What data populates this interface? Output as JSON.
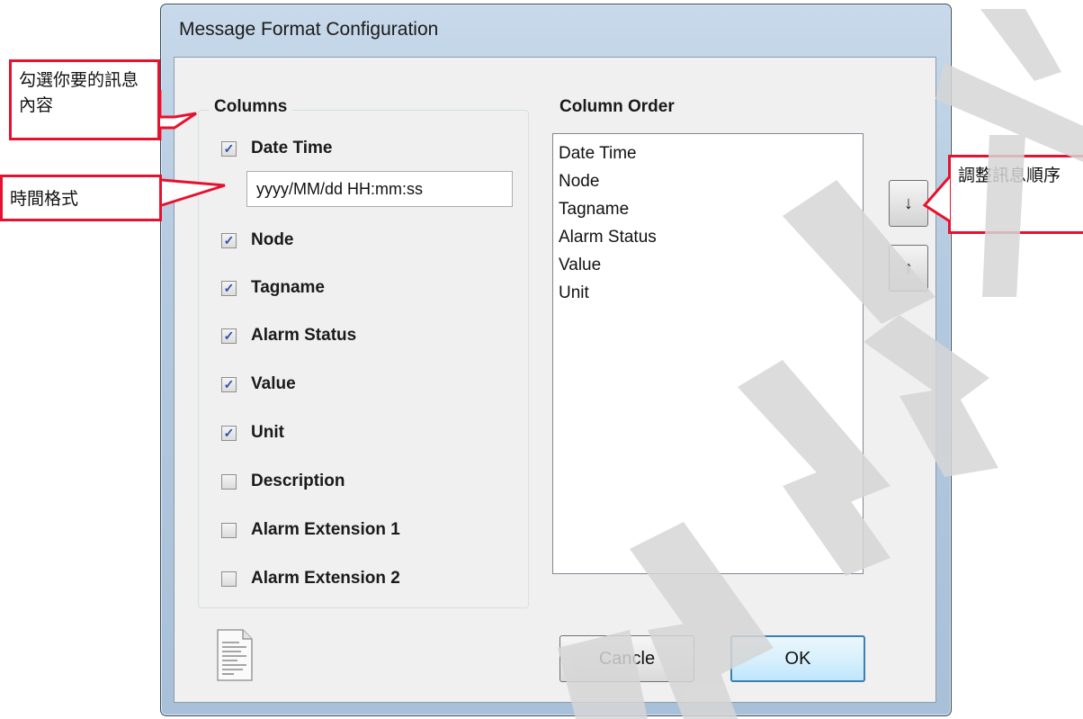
{
  "window": {
    "title": "Message Format Configuration"
  },
  "columns": {
    "group_label": "Columns",
    "items": [
      {
        "label": "Date Time",
        "checked": true
      },
      {
        "label": "Node",
        "checked": true
      },
      {
        "label": "Tagname",
        "checked": true
      },
      {
        "label": "Alarm Status",
        "checked": true
      },
      {
        "label": "Value",
        "checked": true
      },
      {
        "label": "Unit",
        "checked": true
      },
      {
        "label": "Description",
        "checked": false
      },
      {
        "label": "Alarm Extension 1",
        "checked": false
      },
      {
        "label": "Alarm Extension 2",
        "checked": false
      }
    ],
    "date_format_value": "yyyy/MM/dd HH:mm:ss"
  },
  "column_order": {
    "label": "Column Order",
    "items": [
      "Date Time",
      "Node",
      "Tagname",
      "Alarm Status",
      "Value",
      "Unit"
    ],
    "move_down_icon": "↓",
    "move_up_icon": "↑"
  },
  "buttons": {
    "cancel_label": "Cancle",
    "ok_label": "OK"
  },
  "icons": {
    "document": "document-icon"
  },
  "callouts": {
    "select_content": "勾選你要的訊息內容",
    "time_format": "時間格式",
    "adjust_order": "調整訊息順序"
  },
  "colors": {
    "callout_border": "#e8112d",
    "check_mark": "#2a50a8",
    "ok_border": "#3c7fb1"
  }
}
